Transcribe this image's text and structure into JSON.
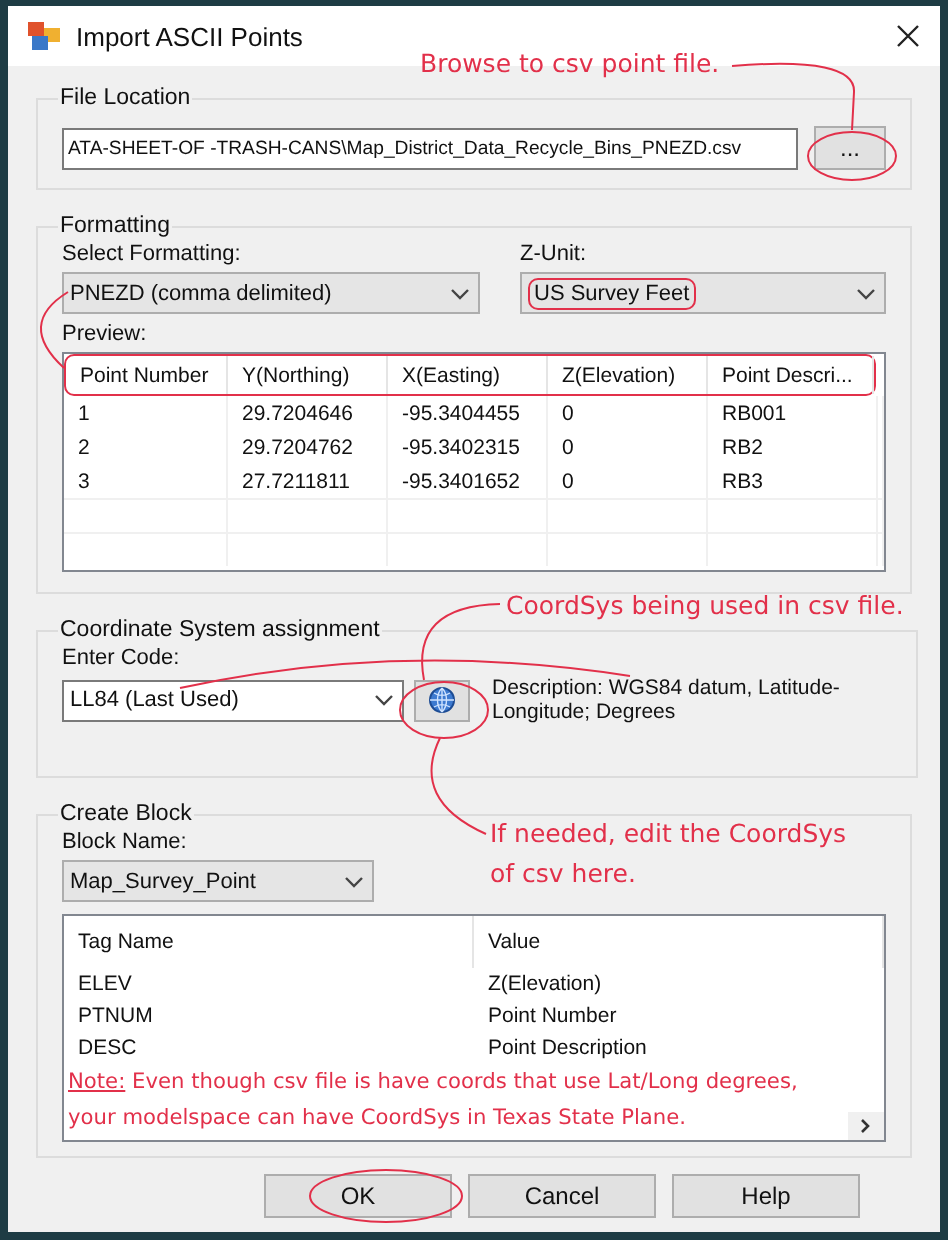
{
  "window": {
    "title": "Import ASCII Points"
  },
  "file_location": {
    "label": "File Location",
    "path": "ATA-SHEET-OF -TRASH-CANS\\Map_District_Data_Recycle_Bins_PNEZD.csv",
    "browse_button": "..."
  },
  "formatting": {
    "label": "Formatting",
    "select_label": "Select Formatting:",
    "select_value": "PNEZD (comma delimited)",
    "zunit_label": "Z-Unit:",
    "zunit_value": "US Survey Feet",
    "preview_label": "Preview:",
    "columns": [
      "Point Number",
      "Y(Northing)",
      "X(Easting)",
      "Z(Elevation)",
      "Point Descri..."
    ],
    "rows": [
      [
        "1",
        "29.7204646",
        "-95.3404455",
        "0",
        "RB001"
      ],
      [
        "2",
        "29.7204762",
        "-95.3402315",
        "0",
        "RB2"
      ],
      [
        "3",
        "27.7211811",
        "-95.3401652",
        "0",
        "RB3"
      ]
    ]
  },
  "coordinate_system": {
    "label": "Coordinate System assignment",
    "code_label": "Enter Code:",
    "code_value": "LL84 (Last Used)",
    "description": "Description: WGS84 datum, Latitude-Longitude; Degrees"
  },
  "create_block": {
    "label": "Create Block",
    "block_name_label": "Block Name:",
    "block_name_value": "Map_Survey_Point",
    "columns": [
      "Tag Name",
      "Value"
    ],
    "rows": [
      [
        "ELEV",
        "Z(Elevation)"
      ],
      [
        "PTNUM",
        "Point Number"
      ],
      [
        "DESC",
        "Point Description"
      ]
    ]
  },
  "buttons": [
    {
      "label": "OK"
    },
    {
      "label": "Cancel"
    },
    {
      "label": "Help"
    }
  ],
  "annotations": [
    {
      "kind": "callout",
      "text": "Browse to csv point file."
    },
    {
      "kind": "callout",
      "text": "CoordSys being used in csv file."
    },
    {
      "kind": "callout",
      "text": "If needed, edit the CoordSys of csv here."
    },
    {
      "kind": "note",
      "label": "Note:",
      "text": "Even though csv file is have coords that use Lat/Long degrees, your modelspace can have CoordSys in Texas State Plane."
    }
  ]
}
